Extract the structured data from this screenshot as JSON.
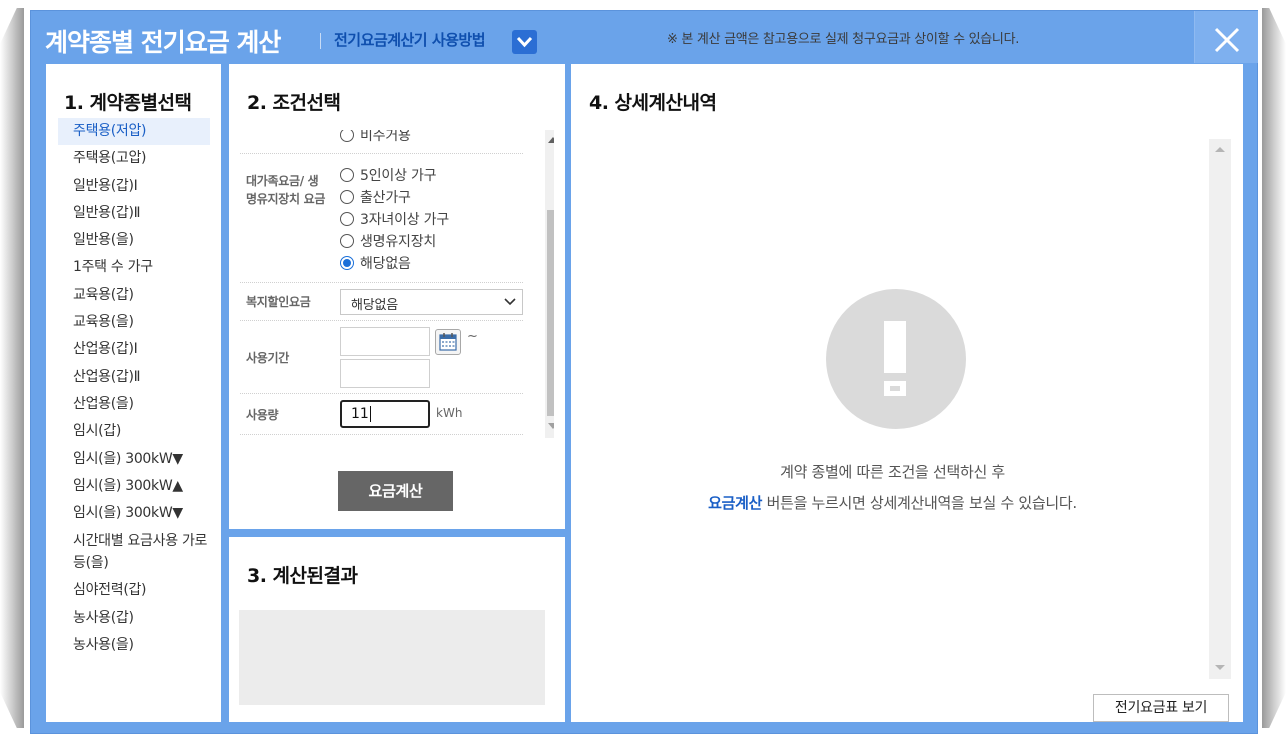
{
  "window": {
    "title": "계약종별 전기요금 계산",
    "howto_label": "전기요금계산기 사용방법",
    "notice": "※ 본 계산 금액은 참고용으로 실제 청구요금과 상이할 수 있습니다.",
    "close_icon": "close-icon",
    "accent_color": "#6aa3ea"
  },
  "contract_panel": {
    "title": "1. 계약종별선택",
    "items": [
      {
        "label": "주택용(저압)"
      },
      {
        "label": "주택용(고압)"
      },
      {
        "label": "일반용(갑)Ⅰ"
      },
      {
        "label": "일반용(갑)Ⅱ"
      },
      {
        "label": "일반용(을)"
      },
      {
        "label": "1주택 수 가구"
      },
      {
        "label": "교육용(갑)"
      },
      {
        "label": "교육용(을)"
      },
      {
        "label": "산업용(갑)Ⅰ"
      },
      {
        "label": "산업용(갑)Ⅱ"
      },
      {
        "label": "산업용(을)"
      },
      {
        "label": "임시(갑)"
      },
      {
        "label": "임시(을) 300kW▼"
      },
      {
        "label": "임시(을) 300kW▲"
      },
      {
        "label": "임시(을) 300kW▼"
      },
      {
        "label": "시간대별 요금사용 가로등(을)"
      },
      {
        "label": "심야전력(갑)"
      },
      {
        "label": "농사용(갑)"
      },
      {
        "label": "농사용(을)"
      }
    ],
    "selected": "주택용(저압)"
  },
  "conditions_panel": {
    "title": "2. 조건선택",
    "prev_option_partial": "비주거용",
    "family_label": "대가족요금/ 생명유지장치 요금",
    "family_options": [
      {
        "label": "5인이상 가구",
        "checked": false
      },
      {
        "label": "출산가구",
        "checked": false
      },
      {
        "label": "3자녀이상 가구",
        "checked": false
      },
      {
        "label": "생명유지장치",
        "checked": false
      },
      {
        "label": "해당없음",
        "checked": true
      }
    ],
    "welfare_label": "복지할인요금",
    "welfare_value": "해당없음",
    "period_label": "사용기간",
    "period_start": "",
    "period_end": "",
    "period_separator": "~",
    "calendar_icon": "calendar-icon",
    "usage_label": "사용량",
    "usage_value": "11",
    "usage_unit": "kWh",
    "calc_button": "요금계산"
  },
  "result_panel": {
    "title": "3. 계산된결과"
  },
  "detail_panel": {
    "title": "4. 상세계산내역",
    "empty_icon": "warning-icon",
    "message_line1": "계약 종별에 따른 조건을 선택하신 후",
    "message_link": "요금계산",
    "message_line2": "버튼을 누르시면 상세계산내역을 보실 수 있습니다.",
    "table_button": "전기요금표 보기"
  }
}
